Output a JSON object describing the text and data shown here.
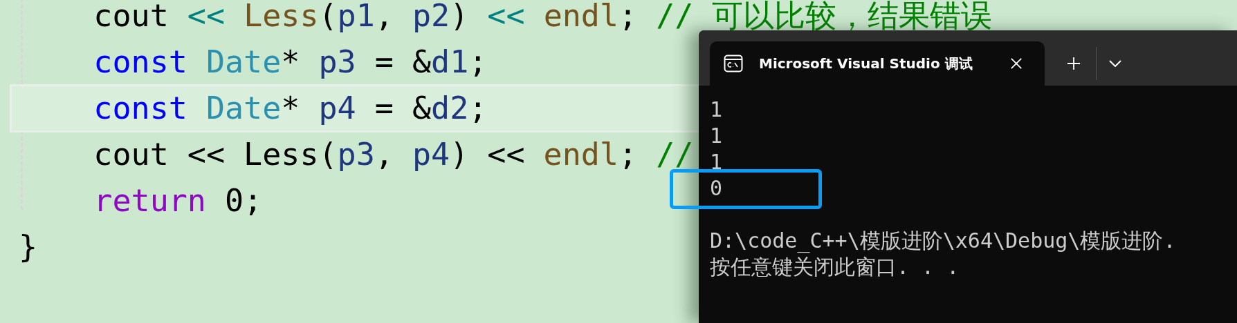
{
  "editor": {
    "lines": [
      {
        "current": false,
        "tokens": [
          {
            "kind": "plain",
            "text": "    cout "
          },
          {
            "kind": "operator",
            "text": "<< "
          },
          {
            "kind": "function",
            "text": "Less"
          },
          {
            "kind": "plain",
            "text": "("
          },
          {
            "kind": "param",
            "text": "p1"
          },
          {
            "kind": "plain",
            "text": ", "
          },
          {
            "kind": "param",
            "text": "p2"
          },
          {
            "kind": "plain",
            "text": ") "
          },
          {
            "kind": "operator",
            "text": "<< "
          },
          {
            "kind": "function",
            "text": "endl"
          },
          {
            "kind": "plain",
            "text": "; "
          },
          {
            "kind": "comment",
            "text": "// 可以比较，结果错误"
          }
        ]
      },
      {
        "current": false,
        "tokens": [
          {
            "kind": "keyword",
            "text": "    const "
          },
          {
            "kind": "type",
            "text": "Date"
          },
          {
            "kind": "plain",
            "text": "* "
          },
          {
            "kind": "param",
            "text": "p3"
          },
          {
            "kind": "plain",
            "text": " = &"
          },
          {
            "kind": "param",
            "text": "d1"
          },
          {
            "kind": "plain",
            "text": ";"
          }
        ]
      },
      {
        "current": true,
        "tokens": [
          {
            "kind": "keyword",
            "text": "    const "
          },
          {
            "kind": "type",
            "text": "Date"
          },
          {
            "kind": "plain",
            "text": "* "
          },
          {
            "kind": "param",
            "text": "p4"
          },
          {
            "kind": "plain",
            "text": " = &"
          },
          {
            "kind": "param",
            "text": "d2"
          },
          {
            "kind": "plain",
            "text": ";"
          }
        ]
      },
      {
        "current": false,
        "tokens": [
          {
            "kind": "plain",
            "text": "    cout << Less("
          },
          {
            "kind": "param",
            "text": "p3"
          },
          {
            "kind": "plain",
            "text": ", "
          },
          {
            "kind": "param",
            "text": "p4"
          },
          {
            "kind": "plain",
            "text": ") << "
          },
          {
            "kind": "function",
            "text": "endl"
          },
          {
            "kind": "plain",
            "text": "; "
          },
          {
            "kind": "comment",
            "text": "//"
          }
        ]
      },
      {
        "current": false,
        "tokens": [
          {
            "kind": "control",
            "text": "    return "
          },
          {
            "kind": "plain",
            "text": "0;"
          }
        ]
      },
      {
        "current": false,
        "tokens": [
          {
            "kind": "plain",
            "text": "}"
          }
        ]
      }
    ]
  },
  "terminal": {
    "tab": {
      "title": "Microsoft Visual Studio 调试",
      "selected": true
    },
    "output_blocks": [
      [
        {
          "text": "1",
          "highlighted": false
        },
        {
          "text": "1",
          "highlighted": false
        },
        {
          "text": "1",
          "highlighted": false
        },
        {
          "text": "0",
          "highlighted": true
        }
      ],
      [
        {
          "text": "D:\\code_C++\\模版进阶\\x64\\Debug\\模版进阶.",
          "highlighted": false
        },
        {
          "text": "按任意键关闭此窗口. . .",
          "highlighted": false
        }
      ]
    ]
  }
}
